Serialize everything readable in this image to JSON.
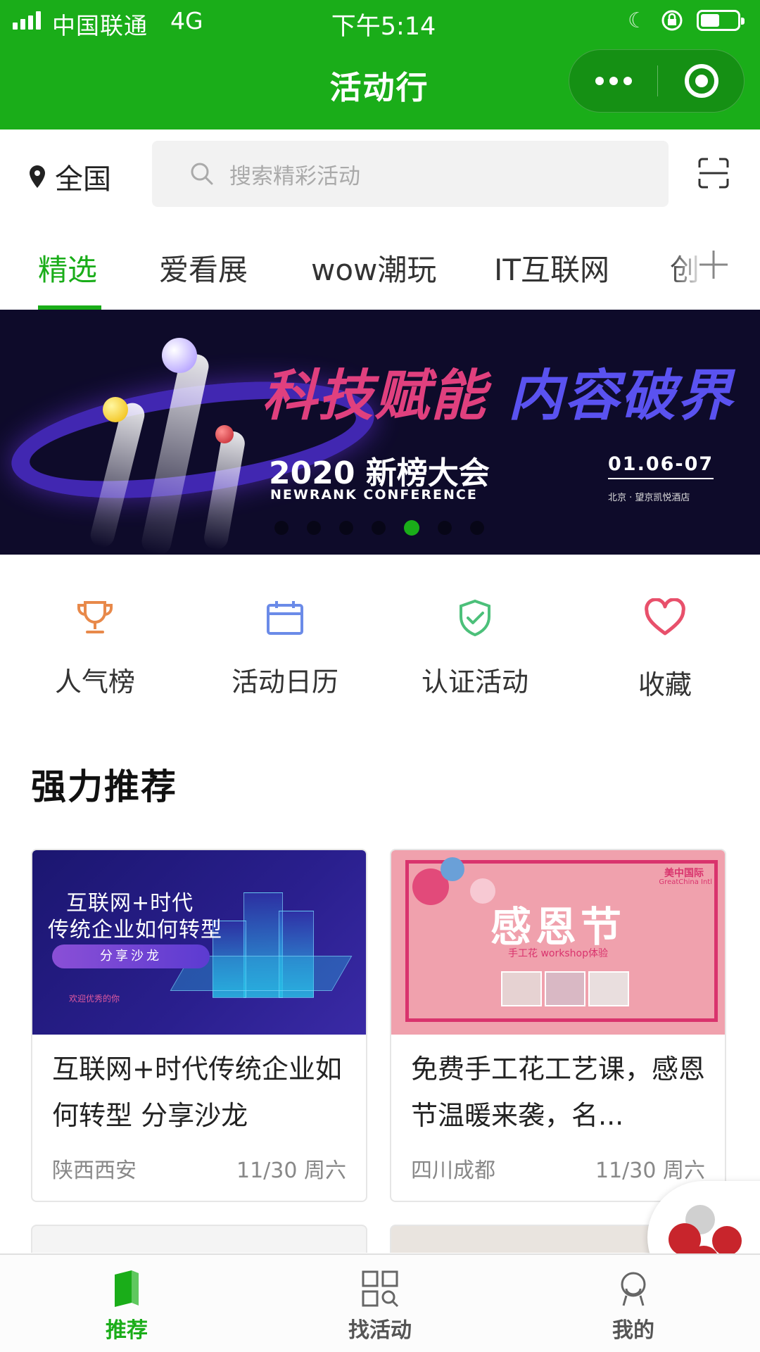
{
  "status_bar": {
    "carrier": "中国联通",
    "network": "4G",
    "time": "下午5:14"
  },
  "nav": {
    "title": "活动行"
  },
  "location": {
    "label": "全国"
  },
  "search": {
    "placeholder": "搜索精彩活动"
  },
  "tabs": [
    {
      "label": "精选",
      "active": true
    },
    {
      "label": "爱看展",
      "active": false
    },
    {
      "label": "wow潮玩",
      "active": false
    },
    {
      "label": "IT互联网",
      "active": false
    },
    {
      "label": "创",
      "active": false
    }
  ],
  "banner": {
    "headline_left": "科技赋能",
    "headline_right": "内容破界",
    "event": "2020 新榜大会",
    "event_en": "NEWRANK CONFERENCE",
    "date": "01.06-07",
    "venue": "北京 · 望京凯悦酒店",
    "slide_count": 7,
    "active_slide": 5
  },
  "quick_entries": [
    {
      "label": "人气榜",
      "icon": "trophy-icon",
      "color": "#e8894a"
    },
    {
      "label": "活动日历",
      "icon": "calendar-icon",
      "color": "#6b8be8"
    },
    {
      "label": "认证活动",
      "icon": "shield-check-icon",
      "color": "#4cc07a"
    },
    {
      "label": "收藏",
      "icon": "heart-icon",
      "color": "#e8506b"
    }
  ],
  "section": {
    "title": "强力推荐"
  },
  "cards": [
    {
      "title": "互联网+时代传统企业如何转型 分享沙龙",
      "location": "陕西西安",
      "date": "11/30 周六",
      "image": {
        "line1": "互联网+时代",
        "line2": "传统企业如何转型",
        "pill": "分享沙龙",
        "sub": "欢迎优秀的你"
      }
    },
    {
      "title": "免费手工花工艺课，感恩节温暖来袭，名...",
      "location": "四川成都",
      "date": "11/30 周六",
      "image": {
        "big": "感恩节",
        "small": "手工花 workshop体验",
        "logo": "美中国际",
        "logo_en": "GreatChina Intl"
      }
    }
  ],
  "bottom_tabs": [
    {
      "label": "推荐",
      "icon": "book-icon",
      "active": true
    },
    {
      "label": "找活动",
      "icon": "grid-search-icon",
      "active": false
    },
    {
      "label": "我的",
      "icon": "person-icon",
      "active": false
    }
  ],
  "colors": {
    "brand": "#1aad19",
    "brand_dark": "#159014"
  }
}
